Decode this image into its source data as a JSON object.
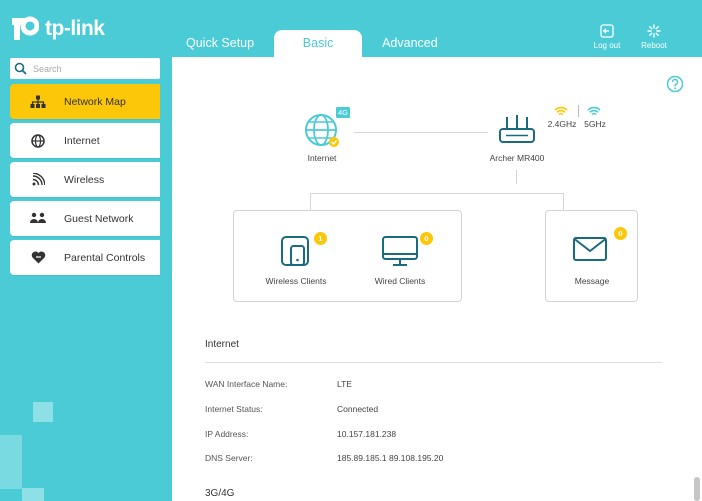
{
  "brand": {
    "logo_text": "tp-link"
  },
  "header": {
    "tabs": [
      {
        "label": "Quick Setup",
        "active": false
      },
      {
        "label": "Basic",
        "active": true
      },
      {
        "label": "Advanced",
        "active": false
      }
    ],
    "logout_label": "Log out",
    "reboot_label": "Reboot"
  },
  "sidebar": {
    "search_placeholder": "Search",
    "items": [
      {
        "label": "Network Map",
        "icon": "network-map-icon",
        "active": true
      },
      {
        "label": "Internet",
        "icon": "globe-icon",
        "active": false
      },
      {
        "label": "Wireless",
        "icon": "wireless-icon",
        "active": false
      },
      {
        "label": "Guest Network",
        "icon": "guest-icon",
        "active": false
      },
      {
        "label": "Parental Controls",
        "icon": "heart-icon",
        "active": false
      }
    ]
  },
  "map": {
    "internet_label": "Internet",
    "internet_badge": "4G",
    "router_label": "Archer MR400",
    "band_24": "2.4GHz",
    "band_5": "5GHz",
    "wireless_clients_label": "Wireless Clients",
    "wireless_clients_count": "1",
    "wired_clients_label": "Wired Clients",
    "wired_clients_count": "0",
    "message_label": "Message",
    "message_count": "0"
  },
  "internet_section": {
    "title": "Internet",
    "rows": [
      {
        "key": "WAN Interface Name:",
        "value": "LTE"
      },
      {
        "key": "Internet Status:",
        "value": "Connected"
      },
      {
        "key": "IP Address:",
        "value": "10.157.181.238"
      },
      {
        "key": "DNS Server:",
        "value": "185.89.185.1 89.108.195.20"
      }
    ]
  },
  "next_section_title": "3G/4G",
  "colors": {
    "accent": "#4acbd6",
    "active": "#fcc708",
    "icon": "#1b6b80"
  }
}
